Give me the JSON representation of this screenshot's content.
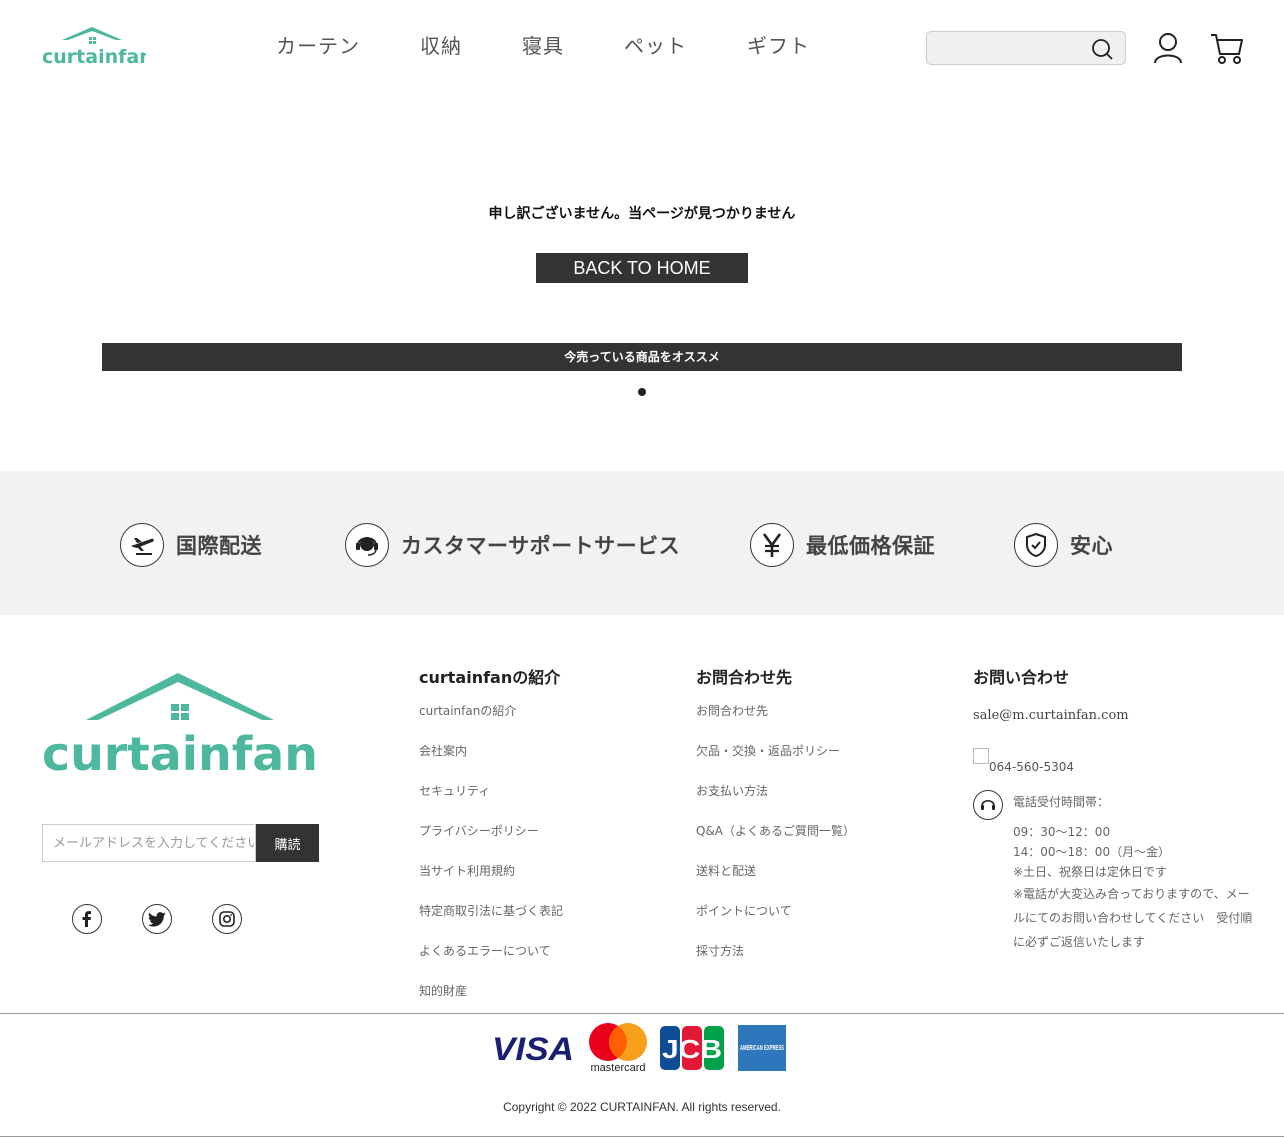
{
  "header": {
    "logo_text": "curtainfan",
    "nav": [
      "カーテン",
      "収納",
      "寝具",
      "ペット",
      "ギフト"
    ],
    "search_placeholder": ""
  },
  "main": {
    "not_found_message": "申し訳ございません。当ページが見つかりません",
    "back_button": "BACK TO HOME",
    "recommend_bar": "今売っている商品をオススメ"
  },
  "features": [
    {
      "label": "国際配送",
      "icon": "plane-icon"
    },
    {
      "label": "カスタマーサポートサービス",
      "icon": "headset-icon"
    },
    {
      "label": "最低価格保証",
      "icon": "yen-icon"
    },
    {
      "label": "安心",
      "icon": "shield-icon"
    }
  ],
  "footer": {
    "logo_text": "curtainfan",
    "newsletter_placeholder": "メールアドレスを入力してください",
    "subscribe_label": "購読",
    "about": {
      "title": "curtainfanの紹介",
      "links": [
        "curtainfanの紹介",
        "会社案内",
        "セキュリティ",
        "プライバシーポリシー",
        "当サイト利用規約",
        "特定商取引法に基づく表記",
        "よくあるエラーについて",
        "知的財産"
      ]
    },
    "inquiry": {
      "title": "お問合わせ先",
      "links": [
        "お問合わせ先",
        "欠品・交換・返品ポリシー",
        "お支払い方法",
        "Q&A（よくあるご質問一覧）",
        "送料と配送",
        "ポイントについて",
        "採寸方法"
      ]
    },
    "contact": {
      "title": "お問い合わせ",
      "email": "sale@m.curtainfan.com",
      "phone": "064-560-5304",
      "hours_label": "電話受付時間帯：",
      "hours_1": "09：30〜12：00",
      "hours_2": "14：00〜18：00（月〜金）",
      "note_1": "※土日、祝祭日は定休日です",
      "note_2": "※電話が大変込み合っておりますので、メールにてのお問い合わせしてください　受付順に必ずご返信いたします"
    },
    "payments": [
      "VISA",
      "mastercard",
      "JCB",
      "AMERICAN EXPRESS"
    ],
    "copyright": "Copyright © 2022 CURTAINFAN. All rights reserved."
  },
  "colors": {
    "brand": "#4db89e",
    "dark": "#333333",
    "band": "#f2f2f2"
  }
}
